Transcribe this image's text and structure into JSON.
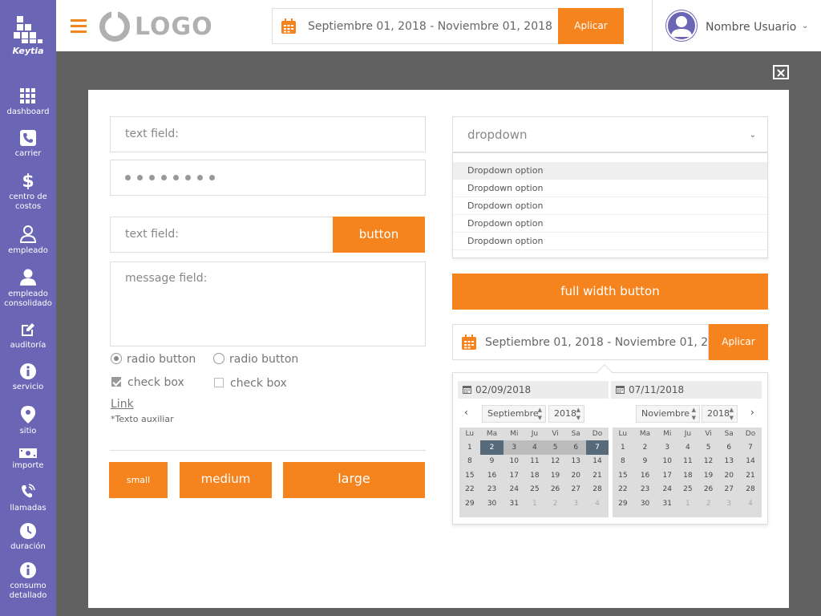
{
  "sidebar": {
    "brand": "Keytia",
    "items": [
      {
        "label": "dashboard",
        "icon": "grid-icon"
      },
      {
        "label": "carrier",
        "icon": "phone-icon"
      },
      {
        "label": "centro de costos",
        "icon": "dollar-icon"
      },
      {
        "label": "empleado",
        "icon": "user-outline-icon"
      },
      {
        "label": "empleado consolidado",
        "icon": "user-filled-icon"
      },
      {
        "label": "auditoría",
        "icon": "edit-icon"
      },
      {
        "label": "servicio",
        "icon": "info-icon"
      },
      {
        "label": "sitio",
        "icon": "map-pin-icon"
      },
      {
        "label": "importe",
        "icon": "money-icon"
      },
      {
        "label": "llamadas",
        "icon": "phone-ring-icon"
      },
      {
        "label": "duración",
        "icon": "clock-icon"
      },
      {
        "label": "consumo detallado",
        "icon": "info-icon"
      }
    ]
  },
  "header": {
    "logo_text": "LOGO",
    "date_range": "Septiembre 01, 2018 - Noviembre 01, 2018",
    "apply_label": "Aplicar",
    "user_name": "Nombre Usuario"
  },
  "form": {
    "text_field_placeholder": "text field:",
    "password_dots": 8,
    "text_field2_placeholder": "text field:",
    "button_label": "button",
    "message_placeholder": "message field:",
    "radio1_label": "radio button",
    "radio2_label": "radio button",
    "check1_label": "check box",
    "check2_label": "check box",
    "link_label": "Link",
    "aux_text": "*Texto auxiliar",
    "small_label": "small",
    "medium_label": "medium",
    "large_label": "large"
  },
  "dropdown": {
    "placeholder": "dropdown",
    "options": [
      "Dropdown option",
      "Dropdown option",
      "Dropdown option",
      "Dropdown option",
      "Dropdown option"
    ]
  },
  "full_width_button": "full width button",
  "date_picker": {
    "range_text": "Septiembre 01, 2018 - Noviembre 01, 2018",
    "apply_label": "Aplicar",
    "start_input": "02/09/2018",
    "end_input": "07/11/2018",
    "weekdays": [
      "Lu",
      "Ma",
      "Mi",
      "Ju",
      "Vi",
      "Sa",
      "Do"
    ],
    "left": {
      "month": "Septiembre",
      "year": "2018",
      "weeks": [
        [
          "1",
          "2",
          "3",
          "4",
          "5",
          "6",
          "7"
        ],
        [
          "8",
          "9",
          "10",
          "11",
          "12",
          "13",
          "14"
        ],
        [
          "15",
          "16",
          "17",
          "18",
          "19",
          "20",
          "21"
        ],
        [
          "22",
          "23",
          "24",
          "25",
          "26",
          "27",
          "28"
        ],
        [
          "29",
          "30",
          "31",
          "1",
          "2",
          "3",
          "4"
        ]
      ]
    },
    "right": {
      "month": "Noviembre",
      "year": "2018",
      "weeks": [
        [
          "1",
          "2",
          "3",
          "4",
          "5",
          "6",
          "7"
        ],
        [
          "8",
          "9",
          "10",
          "11",
          "12",
          "13",
          "14"
        ],
        [
          "15",
          "16",
          "17",
          "18",
          "19",
          "20",
          "21"
        ],
        [
          "22",
          "23",
          "24",
          "25",
          "26",
          "27",
          "28"
        ],
        [
          "29",
          "30",
          "31",
          "1",
          "2",
          "3",
          "4"
        ]
      ]
    }
  },
  "colors": {
    "accent": "#f5841f",
    "sidebar": "#6b65b6",
    "range_edge": "#566a7a"
  }
}
